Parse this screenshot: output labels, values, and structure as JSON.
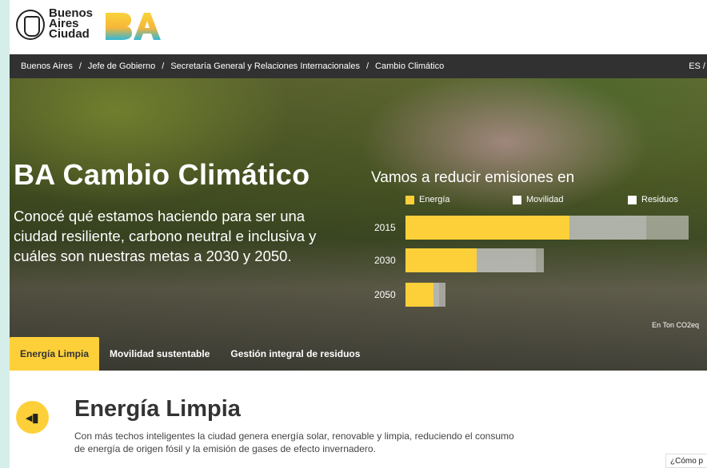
{
  "brand": {
    "lines": [
      "Buenos",
      "Aires",
      "Ciudad"
    ],
    "logo_text": "BA"
  },
  "breadcrumb": {
    "items": [
      "Buenos Aires",
      "Jefe de Gobierno",
      "Secretaría General y Relaciones Internacionales",
      "Cambio Climático"
    ],
    "separator": "/",
    "lang": "ES /"
  },
  "hero": {
    "title": "BA Cambio Climático",
    "subtitle": "Conocé qué estamos haciendo para ser una ciudad resiliente, carbono neutral e inclusiva y cuáles son nuestras metas a 2030 y 2050.",
    "chart_title": "Vamos a reducir emisiones en",
    "unit": "En Ton CO2eq"
  },
  "chart_data": {
    "type": "bar",
    "categories": [
      "2015",
      "2030",
      "2050"
    ],
    "series": [
      {
        "name": "Energía",
        "values": [
          58,
          25,
          10
        ],
        "color": "#fdd03a"
      },
      {
        "name": "Movilidad",
        "values": [
          27,
          21,
          2
        ],
        "color": "#d4d4d4"
      },
      {
        "name": "Residuos",
        "values": [
          15,
          3,
          2
        ],
        "color": "#e6e6e6"
      }
    ],
    "stacked": true,
    "xlim": [
      0,
      100
    ]
  },
  "tabs": [
    {
      "label": "Energía Limpia",
      "active": true
    },
    {
      "label": "Movilidad sustentable",
      "active": false
    },
    {
      "label": "Gestión integral de residuos",
      "active": false
    }
  ],
  "section": {
    "icon": "plug-icon",
    "title": "Energía Limpia",
    "text": "Con más techos inteligentes la ciudad genera energía solar, renovable y limpia, reduciendo el consumo de energía de origen fósil y la emisión de gases de efecto invernadero."
  },
  "help": {
    "label": "¿Cómo p"
  },
  "colors": {
    "accent": "#fdd03a",
    "crumb_bg": "#141414"
  }
}
